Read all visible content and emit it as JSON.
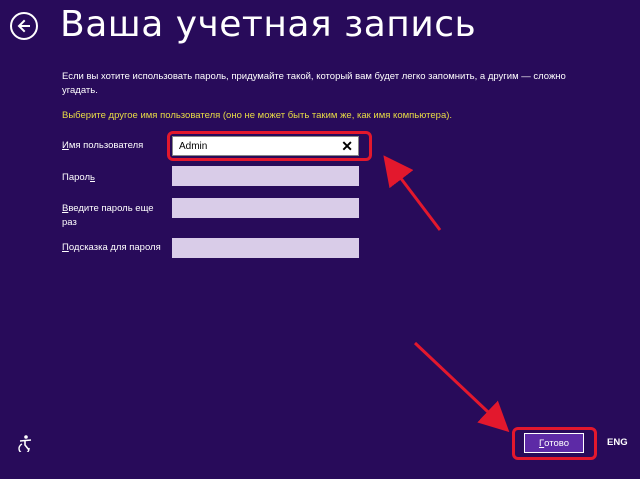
{
  "header": {
    "title": "Ваша учетная запись",
    "back_icon": "back-arrow-icon"
  },
  "intro_text": "Если вы хотите использовать пароль, придумайте такой, который вам будет легко запомнить, а другим — сложно угадать.",
  "warning_text": "Выберите другое имя пользователя (оно не может быть таким же, как имя компьютера).",
  "form": {
    "username": {
      "label_u": "И",
      "label_rest": "мя пользователя",
      "value": "Admin",
      "clear_icon": "close-icon"
    },
    "password": {
      "label_pre": "Парол",
      "label_u": "ь",
      "value": ""
    },
    "password_confirm": {
      "label_u": "В",
      "label_rest": "ведите пароль еще раз",
      "value": ""
    },
    "hint": {
      "label_u": "П",
      "label_rest": "одсказка для пароля",
      "value": ""
    }
  },
  "footer": {
    "done_u": "Г",
    "done_rest": "отово",
    "language": "ENG",
    "ease_of_access_icon": "ease-of-access-icon"
  },
  "colors": {
    "background": "#280b5a",
    "warning": "#e8dc45",
    "annotation": "#e3182d"
  }
}
